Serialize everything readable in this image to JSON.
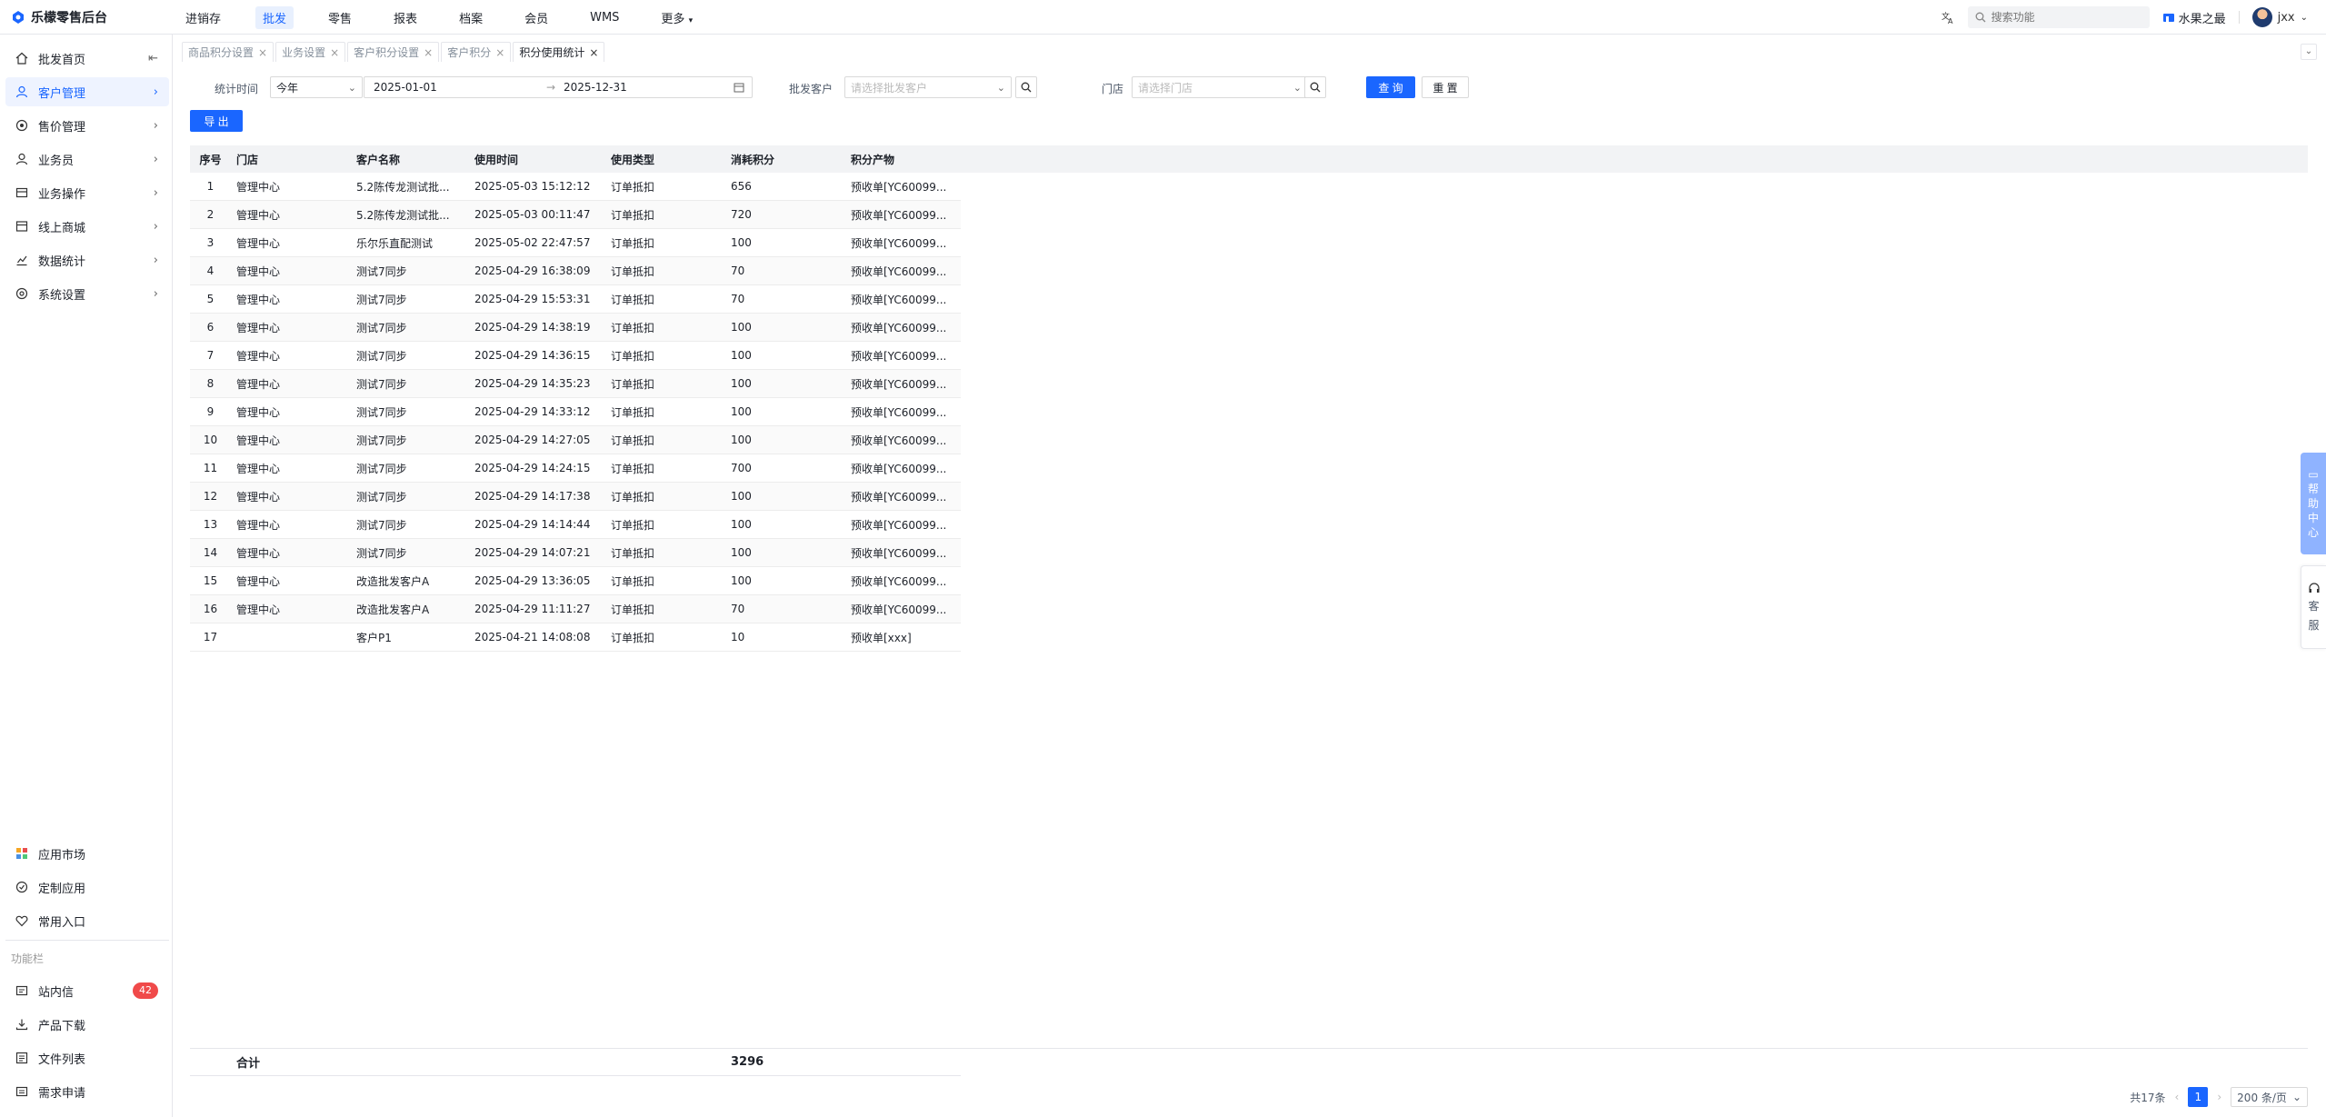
{
  "app": {
    "title": "乐檬零售后台"
  },
  "topnav": [
    "进销存",
    "批发",
    "零售",
    "报表",
    "档案",
    "会员",
    "WMS",
    "更多"
  ],
  "topright": {
    "search_placeholder": "搜索功能",
    "store": "水果之最",
    "user": "jxx"
  },
  "sidebar": {
    "items": [
      "批发首页",
      "客户管理",
      "售价管理",
      "业务员",
      "业务操作",
      "线上商城",
      "数据统计",
      "系统设置"
    ],
    "bottom": [
      "应用市场",
      "定制应用",
      "常用入口"
    ],
    "caption": "功能栏",
    "tools": [
      "站内信",
      "产品下载",
      "文件列表",
      "需求申请"
    ],
    "mail_badge": "42"
  },
  "tabs": [
    "商品积分设置",
    "业务设置",
    "客户积分设置",
    "客户积分",
    "积分使用统计"
  ],
  "filters": {
    "time_label": "统计时间",
    "time_range": "今年",
    "date_start": "2025-01-01",
    "date_sep": "→",
    "date_end": "2025-12-31",
    "customer_label": "批发客户",
    "customer_placeholder": "请选择批发客户",
    "store_label": "门店",
    "store_placeholder": "请选择门店",
    "query": "查 询",
    "reset": "重 置",
    "export": "导 出"
  },
  "table": {
    "columns": [
      "序号",
      "门店",
      "客户名称",
      "使用时间",
      "使用类型",
      "消耗积分",
      "积分产物"
    ],
    "rows": [
      [
        "1",
        "管理中心",
        "5.2陈传龙测试批...",
        "2025-05-03 15:12:12",
        "订单抵扣",
        "656",
        "预收单[YC60099..."
      ],
      [
        "2",
        "管理中心",
        "5.2陈传龙测试批...",
        "2025-05-03 00:11:47",
        "订单抵扣",
        "720",
        "预收单[YC60099..."
      ],
      [
        "3",
        "管理中心",
        "乐尔乐直配测试",
        "2025-05-02 22:47:57",
        "订单抵扣",
        "100",
        "预收单[YC60099..."
      ],
      [
        "4",
        "管理中心",
        "测试7同步",
        "2025-04-29 16:38:09",
        "订单抵扣",
        "70",
        "预收单[YC60099..."
      ],
      [
        "5",
        "管理中心",
        "测试7同步",
        "2025-04-29 15:53:31",
        "订单抵扣",
        "70",
        "预收单[YC60099..."
      ],
      [
        "6",
        "管理中心",
        "测试7同步",
        "2025-04-29 14:38:19",
        "订单抵扣",
        "100",
        "预收单[YC60099..."
      ],
      [
        "7",
        "管理中心",
        "测试7同步",
        "2025-04-29 14:36:15",
        "订单抵扣",
        "100",
        "预收单[YC60099..."
      ],
      [
        "8",
        "管理中心",
        "测试7同步",
        "2025-04-29 14:35:23",
        "订单抵扣",
        "100",
        "预收单[YC60099..."
      ],
      [
        "9",
        "管理中心",
        "测试7同步",
        "2025-04-29 14:33:12",
        "订单抵扣",
        "100",
        "预收单[YC60099..."
      ],
      [
        "10",
        "管理中心",
        "测试7同步",
        "2025-04-29 14:27:05",
        "订单抵扣",
        "100",
        "预收单[YC60099..."
      ],
      [
        "11",
        "管理中心",
        "测试7同步",
        "2025-04-29 14:24:15",
        "订单抵扣",
        "700",
        "预收单[YC60099..."
      ],
      [
        "12",
        "管理中心",
        "测试7同步",
        "2025-04-29 14:17:38",
        "订单抵扣",
        "100",
        "预收单[YC60099..."
      ],
      [
        "13",
        "管理中心",
        "测试7同步",
        "2025-04-29 14:14:44",
        "订单抵扣",
        "100",
        "预收单[YC60099..."
      ],
      [
        "14",
        "管理中心",
        "测试7同步",
        "2025-04-29 14:07:21",
        "订单抵扣",
        "100",
        "预收单[YC60099..."
      ],
      [
        "15",
        "管理中心",
        "改造批发客户A",
        "2025-04-29 13:36:05",
        "订单抵扣",
        "100",
        "预收单[YC60099..."
      ],
      [
        "16",
        "管理中心",
        "改造批发客户A",
        "2025-04-29 11:11:27",
        "订单抵扣",
        "70",
        "预收单[YC60099..."
      ],
      [
        "17",
        "",
        "客户P1",
        "2025-04-21 14:08:08",
        "订单抵扣",
        "10",
        "预收单[xxx]"
      ]
    ],
    "total_label": "合计",
    "total_points": "3296"
  },
  "pagination": {
    "total": "共17条",
    "current": "1",
    "page_size": "200 条/页"
  },
  "float": {
    "help": [
      "帮",
      "助",
      "中",
      "心"
    ],
    "service": [
      "客",
      "服"
    ]
  },
  "colors": {
    "accent": "#1a66ff",
    "badge": "#f04a4a"
  }
}
